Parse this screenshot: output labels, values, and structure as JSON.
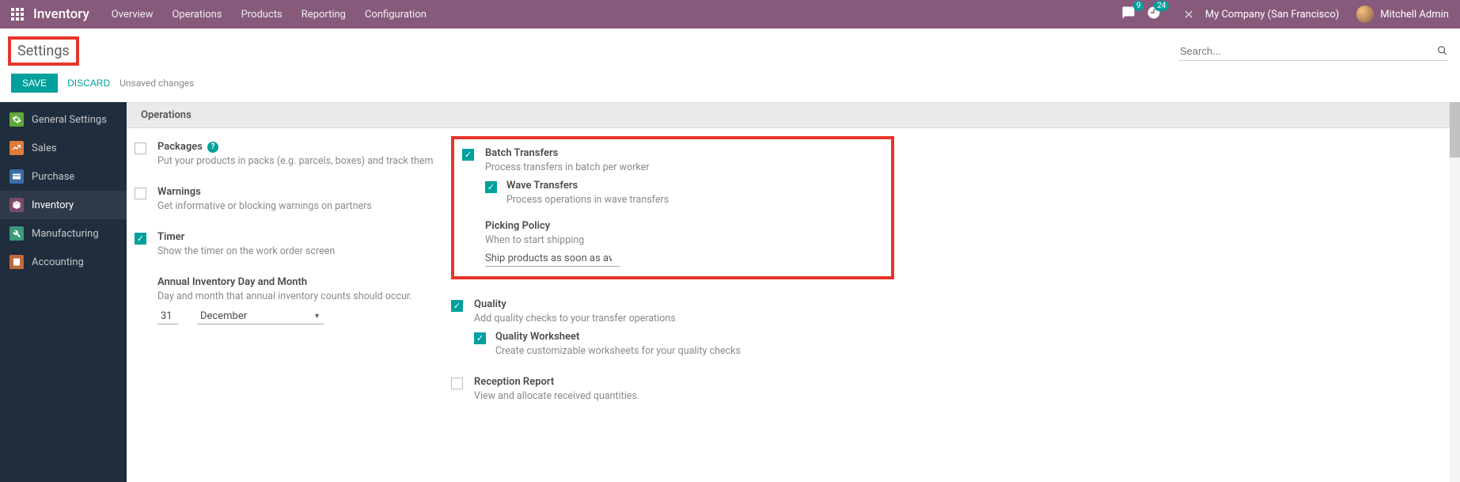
{
  "topnav": {
    "brand": "Inventory",
    "items": [
      "Overview",
      "Operations",
      "Products",
      "Reporting",
      "Configuration"
    ],
    "msg_badge": "9",
    "activity_badge": "24",
    "company": "My Company (San Francisco)",
    "user": "Mitchell Admin"
  },
  "breadcrumb": {
    "title": "Settings"
  },
  "search": {
    "placeholder": "Search..."
  },
  "actions": {
    "save": "SAVE",
    "discard": "DISCARD",
    "unsaved": "Unsaved changes"
  },
  "sidebar": {
    "items": [
      {
        "label": "General Settings"
      },
      {
        "label": "Sales"
      },
      {
        "label": "Purchase"
      },
      {
        "label": "Inventory"
      },
      {
        "label": "Manufacturing"
      },
      {
        "label": "Accounting"
      }
    ],
    "active_index": 3
  },
  "section": {
    "title": "Operations"
  },
  "settings": {
    "packages": {
      "title": "Packages",
      "desc": "Put your products in packs (e.g. parcels, boxes) and track them",
      "checked": false
    },
    "warnings": {
      "title": "Warnings",
      "desc": "Get informative or blocking warnings on partners",
      "checked": false
    },
    "timer": {
      "title": "Timer",
      "desc": "Show the timer on the work order screen",
      "checked": true
    },
    "annual": {
      "title": "Annual Inventory Day and Month",
      "desc": "Day and month that annual inventory counts should occur.",
      "day": "31",
      "month": "December"
    },
    "batch": {
      "title": "Batch Transfers",
      "desc": "Process transfers in batch per worker",
      "checked": true,
      "wave_title": "Wave Transfers",
      "wave_desc": "Process operations in wave transfers",
      "wave_checked": true
    },
    "picking": {
      "title": "Picking Policy",
      "desc": "When to start shipping",
      "value": "Ship products as soon as available"
    },
    "quality": {
      "title": "Quality",
      "desc": "Add quality checks to your transfer operations",
      "checked": true,
      "ws_title": "Quality Worksheet",
      "ws_desc": "Create customizable worksheets for your quality checks",
      "ws_checked": true
    },
    "reception": {
      "title": "Reception Report",
      "desc": "View and allocate received quantities.",
      "checked": false
    }
  }
}
